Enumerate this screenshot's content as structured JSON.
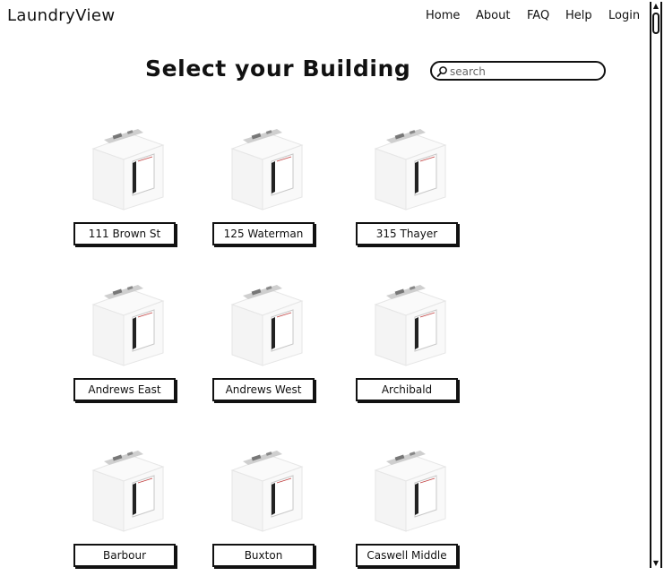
{
  "header": {
    "logo": "LaundryView",
    "nav": {
      "home": "Home",
      "about": "About",
      "faq": "FAQ",
      "help": "Help",
      "login": "Login"
    }
  },
  "main": {
    "title": "Select your Building",
    "search": {
      "placeholder": "search",
      "value": "",
      "icon": "search-icon"
    },
    "buildings": [
      {
        "label": "111 Brown St",
        "icon": "washing-machine-icon"
      },
      {
        "label": "125 Waterman",
        "icon": "washing-machine-icon"
      },
      {
        "label": "315 Thayer",
        "icon": "washing-machine-icon"
      },
      {
        "label": "Andrews East",
        "icon": "washing-machine-icon"
      },
      {
        "label": "Andrews West",
        "icon": "washing-machine-icon"
      },
      {
        "label": "Archibald",
        "icon": "washing-machine-icon"
      },
      {
        "label": "Barbour",
        "icon": "washing-machine-icon"
      },
      {
        "label": "Buxton",
        "icon": "washing-machine-icon"
      },
      {
        "label": "Caswell Middle",
        "icon": "washing-machine-icon"
      }
    ]
  },
  "scrollbar": {
    "up_icon": "arrow-up-icon",
    "down_icon": "arrow-down-icon"
  }
}
